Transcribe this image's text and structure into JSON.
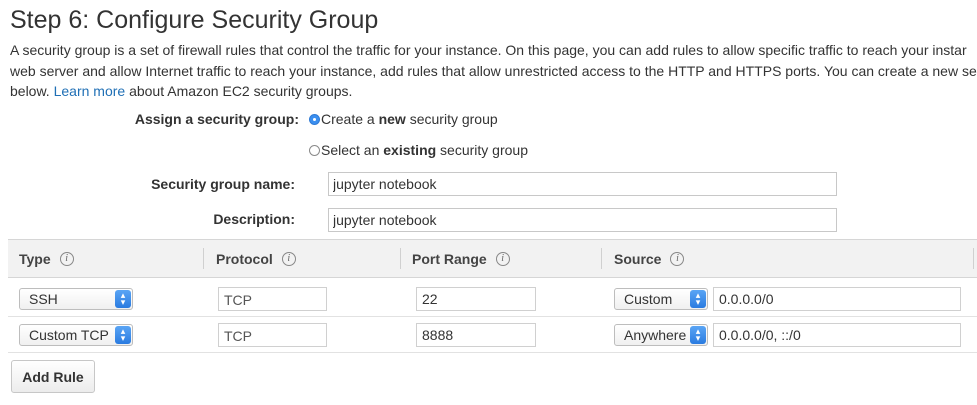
{
  "page": {
    "title": "Step 6: Configure Security Group",
    "description_lines": [
      "A security group is a set of firewall rules that control the traffic for your instance. On this page, you can add rules to allow specific traffic to reach your instar",
      "web server and allow Internet traffic to reach your instance, add rules that allow unrestricted access to the HTTP and HTTPS ports. You can create a new se"
    ],
    "description_tail_prefix": "below.",
    "learn_more": "Learn more",
    "description_tail_suffix": "about Amazon EC2 security groups."
  },
  "form": {
    "assign_label": "Assign a security group:",
    "option_create": {
      "prefix": "Create a ",
      "bold": "new",
      "suffix": " security group",
      "checked": true
    },
    "option_existing": {
      "prefix": "Select an ",
      "bold": "existing",
      "suffix": " security group",
      "checked": false
    },
    "name_label": "Security group name:",
    "name_value": "jupyter notebook",
    "description_label": "Description:",
    "description_value": "jupyter notebook"
  },
  "table": {
    "headers": {
      "type": "Type",
      "protocol": "Protocol",
      "port_range": "Port Range",
      "source": "Source"
    },
    "info_glyph": "i",
    "rows": [
      {
        "type": "SSH",
        "protocol": "TCP",
        "port_range": "22",
        "source_type": "Custom",
        "source_value": "0.0.0.0/0"
      },
      {
        "type": "Custom TCP",
        "protocol": "TCP",
        "port_range": "8888",
        "source_type": "Anywhere",
        "source_value": "0.0.0.0/0, ::/0"
      }
    ]
  },
  "actions": {
    "add_rule": "Add Rule"
  },
  "icons": {
    "stepper": "select-stepper-icon",
    "info": "info-icon"
  },
  "colors": {
    "link": "#1f6fb5",
    "radio_selected": "#3b8ff0",
    "header_bg": "#f2f2f2"
  }
}
